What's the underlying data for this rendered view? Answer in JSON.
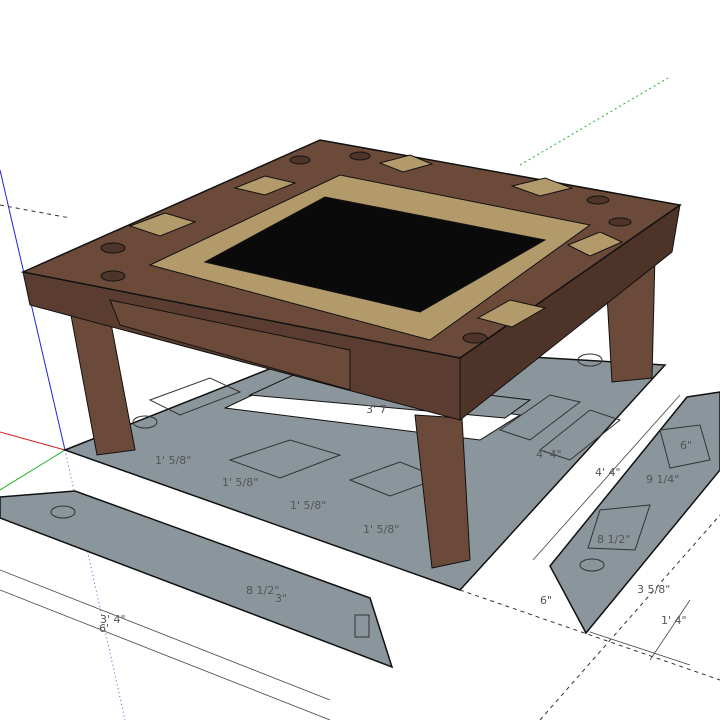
{
  "colors": {
    "wood": "#6b4a3a",
    "wood_dark": "#4e3328",
    "wood_light": "#7a5646",
    "tan_inlay": "#b39a6a",
    "screen": "#0a0a0a",
    "base_gray": "#8b959c",
    "axis_red": "#d02020",
    "axis_green": "#20b020",
    "axis_blue": "#2020e0"
  },
  "dimensions": [
    {
      "id": "table-height",
      "label": "3' 7"
    },
    {
      "id": "frame-seg-1",
      "label": "1' 5/8\""
    },
    {
      "id": "frame-seg-2",
      "label": "1' 5/8\""
    },
    {
      "id": "frame-seg-3",
      "label": "1' 5/8\""
    },
    {
      "id": "frame-seg-4",
      "label": "1' 5/8\""
    },
    {
      "id": "base-length",
      "label": "4' 4\""
    },
    {
      "id": "strip-length",
      "label": "4' 4\""
    },
    {
      "id": "strip-pocket-width",
      "label": "6\""
    },
    {
      "id": "strip-panel",
      "label": "9 1/4\""
    },
    {
      "id": "strip-panel-2",
      "label": "8 1/2\""
    },
    {
      "id": "strip-end",
      "label": "6\""
    },
    {
      "id": "strip-offset",
      "label": "3 5/8\""
    },
    {
      "id": "strip-width",
      "label": "1' 4\""
    },
    {
      "id": "left-strip-panel",
      "label": "8 1/2\""
    },
    {
      "id": "left-strip-inset",
      "label": "3\""
    },
    {
      "id": "left-strip-length",
      "label": "3' 4\""
    },
    {
      "id": "overall",
      "label": "6'"
    }
  ]
}
